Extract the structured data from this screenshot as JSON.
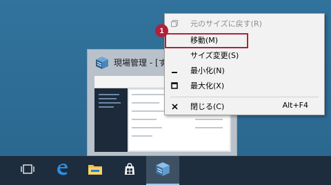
{
  "context_menu": {
    "items": [
      {
        "label": "元のサイズに戻す(R)",
        "icon": "restore-icon",
        "enabled": false,
        "shortcut": ""
      },
      {
        "label": "移動(M)",
        "icon": "",
        "enabled": true,
        "shortcut": ""
      },
      {
        "label": "サイズ変更(S)",
        "icon": "",
        "enabled": true,
        "shortcut": ""
      },
      {
        "label": "最小化(N)",
        "icon": "minimize-icon",
        "enabled": true,
        "shortcut": ""
      },
      {
        "label": "最大化(X)",
        "icon": "maximize-icon",
        "enabled": true,
        "shortcut": ""
      },
      {
        "label": "閉じる(C)",
        "icon": "close-icon",
        "enabled": true,
        "shortcut": "Alt+F4"
      }
    ],
    "highlighted_item": "移動(M)"
  },
  "annotation": {
    "step_number": "1",
    "color": "#b0203c"
  },
  "preview": {
    "title": "現場管理 - [すべ"
  },
  "taskbar": {
    "buttons": [
      "task-view-icon",
      "edge-icon",
      "file-explorer-icon",
      "store-icon",
      "app-icon"
    ],
    "active": "app-icon"
  }
}
